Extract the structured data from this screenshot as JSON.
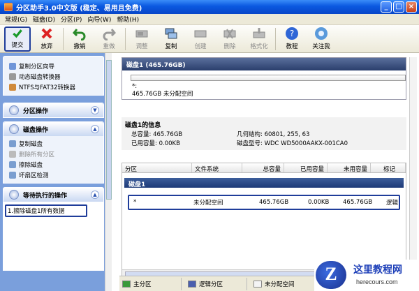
{
  "window": {
    "title": "分区助手3.0中文版 (稳定、易用且免费)"
  },
  "menu": [
    "常规(G)",
    "磁盘(D)",
    "分区(P)",
    "向导(W)",
    "帮助(H)"
  ],
  "toolbar": [
    {
      "label": "提交",
      "icon": "check-icon",
      "enabled": true
    },
    {
      "label": "放弃",
      "icon": "discard-icon",
      "enabled": true
    },
    {
      "label": "撤销",
      "icon": "undo-icon",
      "enabled": true
    },
    {
      "label": "重做",
      "icon": "redo-icon",
      "enabled": false
    },
    {
      "label": "调整",
      "icon": "resize-icon",
      "enabled": false
    },
    {
      "label": "复制",
      "icon": "copy-icon",
      "enabled": true
    },
    {
      "label": "创建",
      "icon": "create-icon",
      "enabled": false
    },
    {
      "label": "删除",
      "icon": "delete-icon",
      "enabled": false
    },
    {
      "label": "格式化",
      "icon": "format-icon",
      "enabled": false
    },
    {
      "label": "教程",
      "icon": "help-icon",
      "enabled": true
    },
    {
      "label": "关注我",
      "icon": "follow-icon",
      "enabled": true
    }
  ],
  "sidebar": {
    "wizards": [
      "复制分区向导",
      "动态磁盘转换器",
      "NTFS与FAT32转换器"
    ],
    "partition_ops": {
      "title": "分区操作"
    },
    "disk_ops": {
      "title": "磁盘操作",
      "items": [
        {
          "label": "复制磁盘",
          "enabled": true
        },
        {
          "label": "删除所有分区",
          "enabled": false
        },
        {
          "label": "擦除磁盘",
          "enabled": true
        },
        {
          "label": "坏扇区检测",
          "enabled": true
        }
      ]
    },
    "pending": {
      "title": "等待执行的操作",
      "items": [
        "1.擦除磁盘1所有数据"
      ]
    }
  },
  "disk_card": {
    "title": "磁盘1 (465.76GB)",
    "marker": "*:",
    "desc": "465.76GB 未分配空间"
  },
  "info": {
    "title": "磁盘1的信息",
    "capacity_label": "总容量:",
    "capacity": "465.76GB",
    "used_label": "已用容量:",
    "used": "0.00KB",
    "geometry_label": "几何结构:",
    "geometry": "60801, 255, 63",
    "model_label": "磁盘型号:",
    "model": "WDC WD5000AAKX-001CA0"
  },
  "table": {
    "headers": [
      "分区",
      "文件系统",
      "总容量",
      "已用容量",
      "未用容量",
      "标记"
    ],
    "group": "磁盘1",
    "rows": [
      {
        "partition": "*",
        "fs": "未分配空间",
        "total": "465.76GB",
        "used": "0.00KB",
        "free": "465.76GB",
        "flag": "逻辑"
      }
    ]
  },
  "legend": [
    "主分区",
    "逻辑分区",
    "未分配空间"
  ],
  "watermark": {
    "logo": "Z",
    "title": "这里教程网",
    "url": "herecours.com"
  },
  "colors": {
    "accent": "#1f3d9a",
    "title_bar": "#0a58e0",
    "sidebar": "#7a9fdc"
  }
}
